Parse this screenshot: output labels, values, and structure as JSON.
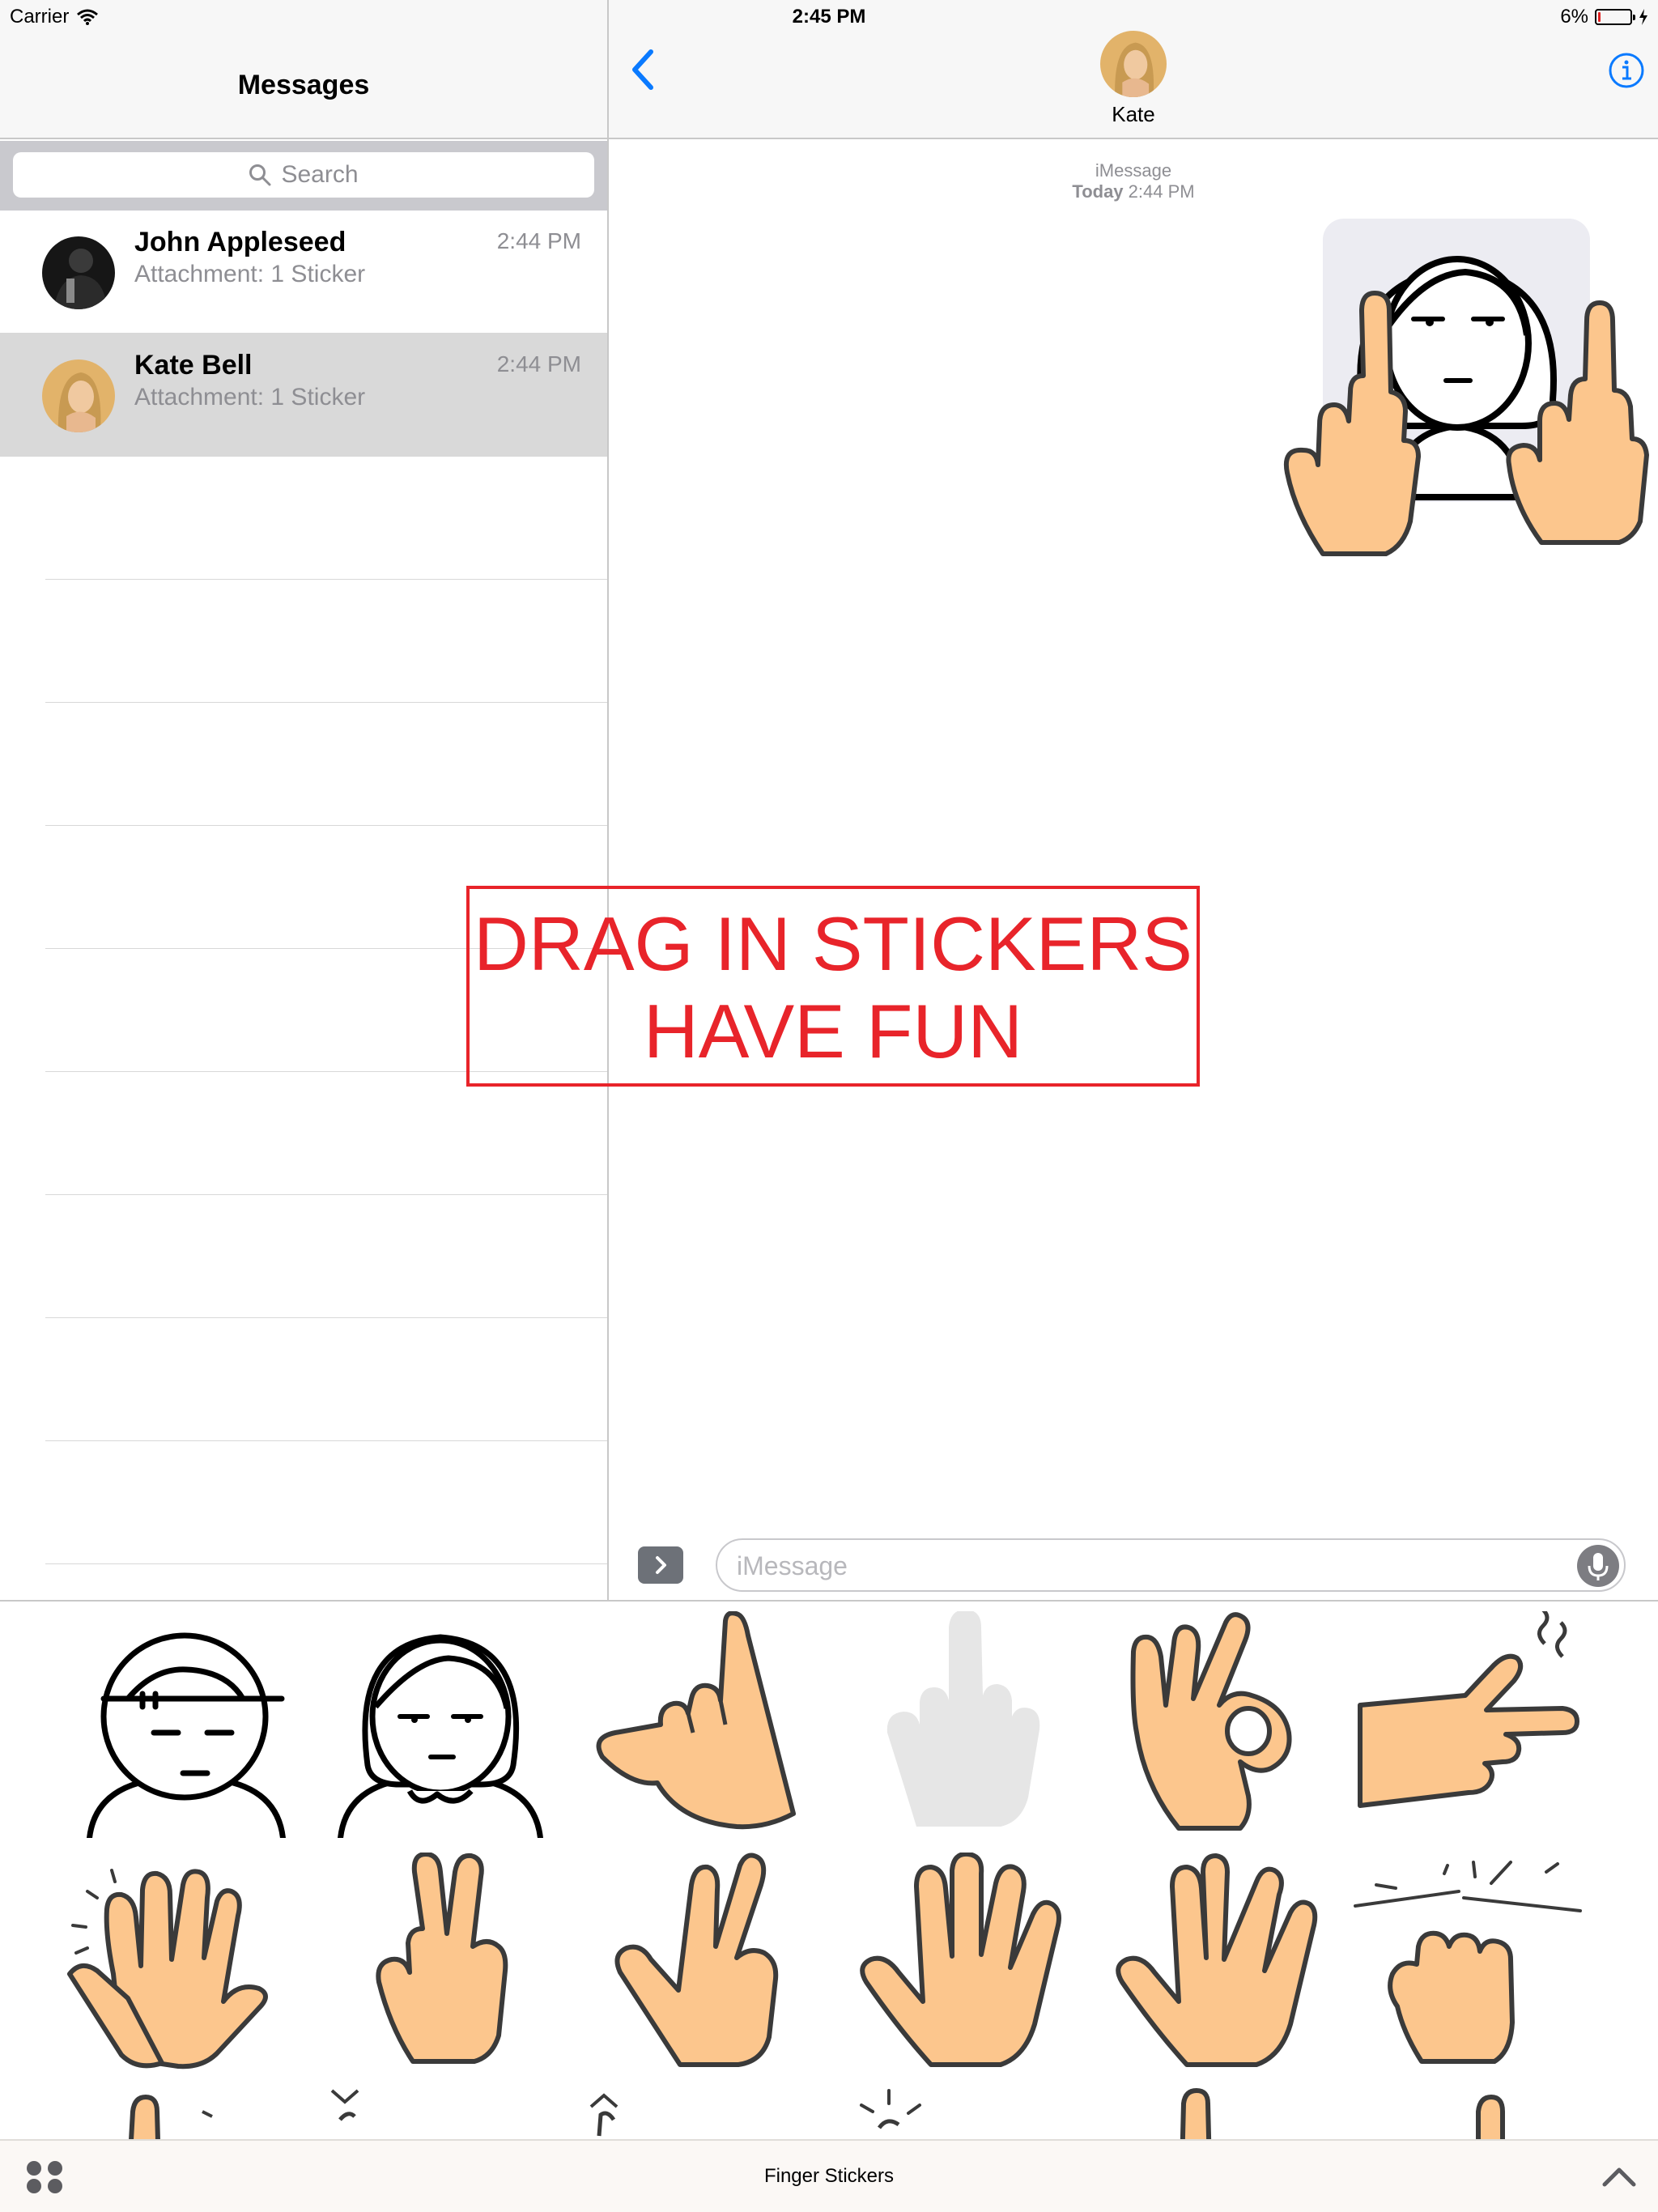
{
  "status_bar": {
    "carrier": "Carrier",
    "time": "2:45 PM",
    "battery": "6%",
    "battery_level": 0.06
  },
  "sidebar": {
    "title": "Messages",
    "search_placeholder": "Search",
    "conversations": [
      {
        "name": "John Appleseed",
        "preview": "Attachment: 1 Sticker",
        "time": "2:44 PM",
        "selected": false
      },
      {
        "name": "Kate Bell",
        "preview": "Attachment: 1 Sticker",
        "time": "2:44 PM",
        "selected": true
      }
    ]
  },
  "chat": {
    "contact_name": "Kate",
    "service": "iMessage",
    "timestamp_day": "Today",
    "timestamp_time": "2:44 PM"
  },
  "overlay": {
    "line1": "DRAG IN STICKERS",
    "line2": "HAVE FUN",
    "color": "#e8242a"
  },
  "compose": {
    "placeholder": "iMessage"
  },
  "app_drawer": {
    "app_name": "Finger Stickers"
  },
  "stickers": [
    "boy-face-icon",
    "girl-face-icon",
    "pointing-hand-icon",
    "middle-finger-icon",
    "ok-hand-icon",
    "finger-gun-icon",
    "clapping-hands-icon",
    "peace-hand-icon",
    "crossed-fingers-icon",
    "open-hand-icon",
    "vulcan-salute-icon",
    "fist-bump-icon"
  ],
  "colors": {
    "accent": "#0a7aff",
    "skin": "#fcc68d",
    "stroke": "#3a3a3a"
  }
}
